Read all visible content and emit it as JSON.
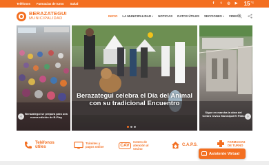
{
  "topbar": {
    "links": [
      "Teléfonos",
      "Farmacias de turno",
      "Salud"
    ],
    "social_icons": [
      "facebook-icon",
      "twitter-icon",
      "instagram-icon",
      "youtube-icon"
    ],
    "weather": {
      "temp": "15",
      "unit": "°C"
    }
  },
  "header": {
    "logo_title": "BERAZATEGUI",
    "logo_subtitle": "MUNICIPALIDAD",
    "nav": [
      {
        "label": "INICIO",
        "active": true
      },
      {
        "label": "LA MUNICIPALIDAD",
        "caret": true
      },
      {
        "label": "NOTICIAS"
      },
      {
        "label": "DATOS ÚTILES"
      },
      {
        "label": "SECCIONES",
        "caret": true
      },
      {
        "label": "VIDEOS"
      }
    ],
    "icons": [
      "search-icon",
      "share-icon"
    ]
  },
  "slider": {
    "left_caption": "Berazategui se prepara para una nueva edición de B-Play",
    "main_caption": "Berazategui celebra el Día del Animal con su tradicional Encuentro",
    "right_caption": "Sigue en marcha la obra del Centro Cívico Municipal El Patio",
    "prev_icon": "chevron-left-icon",
    "next_icon": "chevron-right-icon"
  },
  "quicklinks": [
    {
      "label": "Teléfonos útiles",
      "icon": "phone-icon"
    },
    {
      "label": "Trámites y pagos online",
      "icon": "monitor-icon"
    },
    {
      "label": "Centro de atención al vecino",
      "icon": "cav-icon",
      "badge": "CAV"
    },
    {
      "label": "C.A.P.S.",
      "icon": "health-house-icon"
    },
    {
      "label": "FARMACIAS DE TURNO",
      "icon": "pharmacy-icon"
    }
  ],
  "assistant": {
    "label": "Asistente Virtual"
  },
  "colors": {
    "accent": "#f36f21"
  }
}
